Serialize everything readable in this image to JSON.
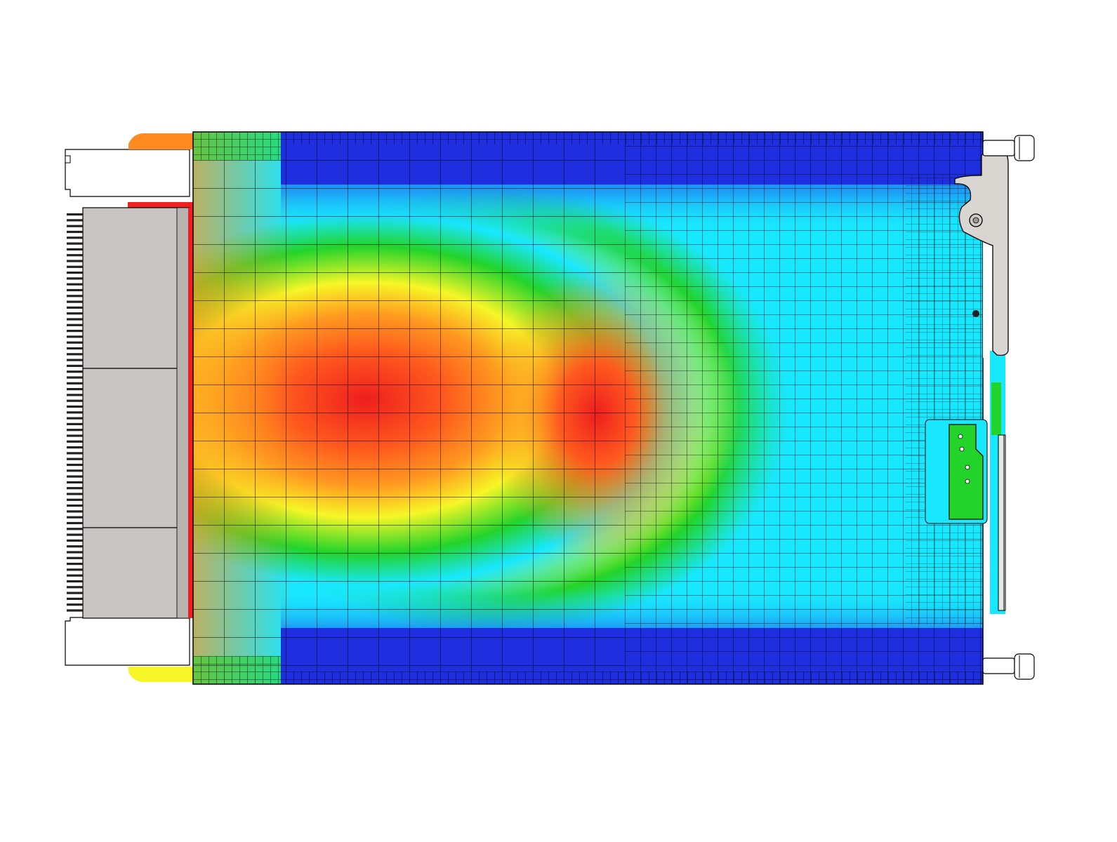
{
  "scene": {
    "kind": "thermal-simulation-plot",
    "description_visible_text": "",
    "colormap": [
      "#1f2fe0",
      "#18e8ff",
      "#22d42a",
      "#f6f626",
      "#ff9320",
      "#ee1e1e"
    ],
    "background_color": "#ffffff",
    "grid_line_color": "#000000",
    "connector_color": "#c8c5c2",
    "handle_color": "#d9d6d2"
  },
  "field": {
    "hotspots": [
      {
        "label": "primary",
        "intensity": 1.0
      },
      {
        "label": "secondary",
        "intensity": 0.9
      }
    ],
    "cold_bands": [
      "top",
      "bottom"
    ]
  }
}
